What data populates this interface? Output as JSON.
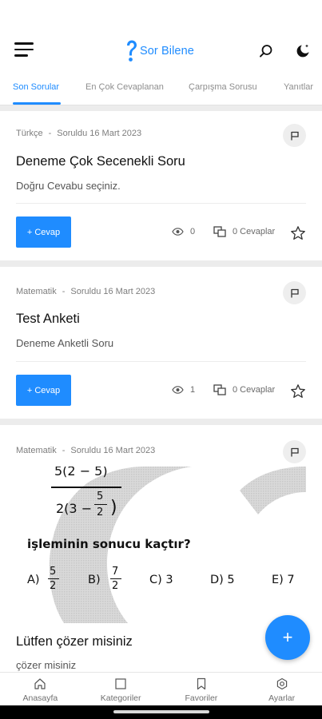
{
  "app": {
    "brand": "Sor Bilene",
    "colors": {
      "accent": "#1f8cff",
      "background": "#ececec",
      "card": "#ffffff"
    },
    "icons": {
      "menu": "menu-icon",
      "search": "search-icon",
      "theme": "moon-icon"
    }
  },
  "tabs": [
    {
      "label": "Son Sorular",
      "active": true
    },
    {
      "label": "En Çok Cevaplanan",
      "active": false
    },
    {
      "label": "Çarpışma Sorusu",
      "active": false
    },
    {
      "label": "Yanıtlar",
      "active": false
    }
  ],
  "questions": [
    {
      "category": "Türkçe",
      "separator": "-",
      "date": "Soruldu 16 Mart 2023",
      "title": "Deneme Çok Secenekli Soru",
      "description": "Doğru Cevabu seçiniz.",
      "answer_button": "+ Cevap",
      "views": "0",
      "answers": "0 Cevaplar"
    },
    {
      "category": "Matematik",
      "separator": "-",
      "date": "Soruldu 16 Mart 2023",
      "title": "Test Anketi",
      "description": "Deneme Anketli Soru",
      "answer_button": "+ Cevap",
      "views": "1",
      "answers": "0 Cevaplar"
    },
    {
      "category": "Matematik",
      "separator": "-",
      "date": "Soruldu 16 Mart 2023",
      "title": "Lütfen çözer misiniz",
      "description": "çözer misiniz",
      "image": {
        "top_numerator": "5(2 − 5)",
        "denominator_lead": "2(3 −",
        "inner_num": "5",
        "inner_den": "2",
        "question_text": "işleminin sonucu kaçtır?",
        "options": [
          {
            "label": "A)",
            "num": "5",
            "den": "2"
          },
          {
            "label": "B)",
            "num": "7",
            "den": "2"
          },
          {
            "label": "C) 3"
          },
          {
            "label": "D) 5"
          },
          {
            "label": "E) 7"
          }
        ]
      }
    }
  ],
  "fab": {
    "label": "+"
  },
  "bottom_nav": [
    {
      "label": "Anasayfa",
      "icon": "home-icon"
    },
    {
      "label": "Kategoriler",
      "icon": "categories-icon"
    },
    {
      "label": "Favoriler",
      "icon": "bookmark-icon"
    },
    {
      "label": "Ayarlar",
      "icon": "settings-icon"
    }
  ]
}
